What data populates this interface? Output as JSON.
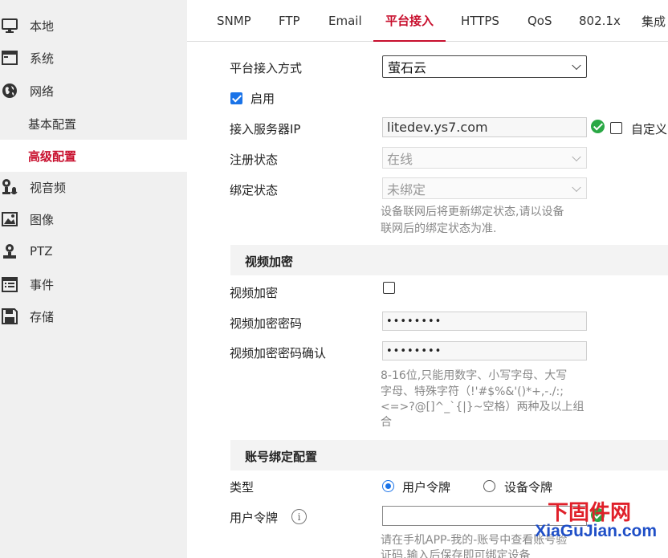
{
  "sidebar": {
    "items": [
      {
        "label": "本地",
        "icon": "monitor-icon"
      },
      {
        "label": "系统",
        "icon": "window-icon"
      },
      {
        "label": "网络",
        "icon": "globe-icon"
      },
      {
        "label": "基本配置"
      },
      {
        "label": "高级配置",
        "active": true
      },
      {
        "label": "视音频",
        "icon": "camera-mic-icon"
      },
      {
        "label": "图像",
        "icon": "image-icon"
      },
      {
        "label": "PTZ",
        "icon": "ptz-icon"
      },
      {
        "label": "事件",
        "icon": "event-list-icon"
      },
      {
        "label": "存储",
        "icon": "floppy-icon"
      }
    ]
  },
  "tabs": [
    "SNMP",
    "FTP",
    "Email",
    "平台接入",
    "HTTPS",
    "QoS",
    "802.1x",
    "集成"
  ],
  "active_tab": "平台接入",
  "form": {
    "access_mode_label": "平台接入方式",
    "access_mode_value": "萤石云",
    "enable_label": "启用",
    "server_ip_label": "接入服务器IP",
    "server_ip_value": "litedev.ys7.com",
    "custom_label": "自定义",
    "reg_status_label": "注册状态",
    "reg_status_value": "在线",
    "bind_status_label": "绑定状态",
    "bind_status_value": "未绑定",
    "bind_hint_1": "设备联网后将更新绑定状态,请以设备",
    "bind_hint_2": "联网后的绑定状态为准."
  },
  "video_encrypt": {
    "section_title": "视频加密",
    "encrypt_label": "视频加密",
    "password_label": "视频加密密码",
    "password_value": "••••••••",
    "confirm_label": "视频加密密码确认",
    "confirm_value": "••••••••",
    "pwd_hint_1": "8-16位,只能用数字、小写字母、大写",
    "pwd_hint_2": "字母、特殊字符（!'#$%&'()*+,-./:;",
    "pwd_hint_3": "<=>?@[]^_`{|}~空格）两种及以上组",
    "pwd_hint_4": "合"
  },
  "account_bind": {
    "section_title": "账号绑定配置",
    "type_label": "类型",
    "option_user": "用户令牌",
    "option_device": "设备令牌",
    "user_token_label": "用户令牌",
    "token_hint_1": "请在手机APP-我的-账号中查看账号验",
    "token_hint_2": "证码,输入后保存即可绑定设备"
  },
  "watermark": {
    "line1": "下固件网",
    "line2": "XiaGuJian.com"
  },
  "colors": {
    "accent": "#c8102e",
    "check_blue": "#1a73e8",
    "ok_green": "#2aa845"
  }
}
